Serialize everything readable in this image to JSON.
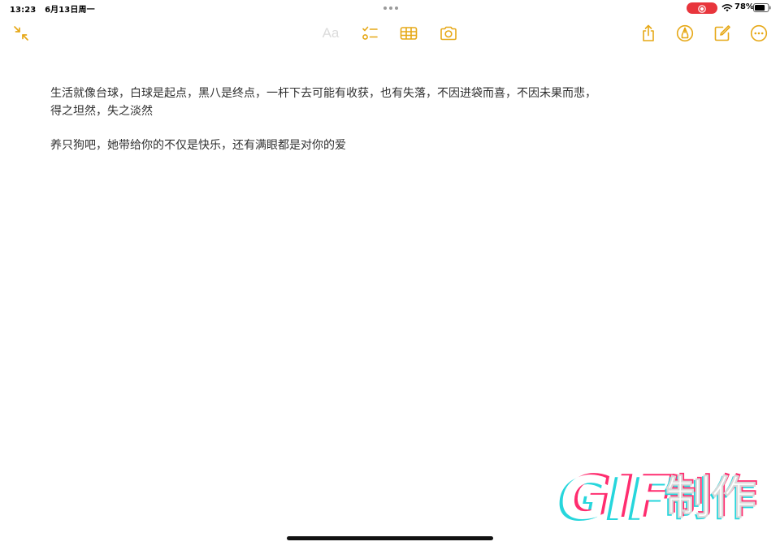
{
  "status_bar": {
    "time": "13:23",
    "date": "6月13日周一",
    "battery_percent": "78%",
    "battery_level": 0.78,
    "screen_recording": true,
    "record_color": "#e8353c"
  },
  "toolbar": {
    "accent_color": "#e6a817",
    "format_label": "Aa",
    "icons": {
      "collapse": "collapse-arrows-icon",
      "checklist": "checklist-icon",
      "table": "table-icon",
      "camera": "camera-icon",
      "share": "share-icon",
      "markup": "markup-pen-icon",
      "compose": "compose-icon",
      "more": "more-ellipsis-icon"
    }
  },
  "note": {
    "paragraphs": [
      {
        "lines": [
          "生活就像台球，白球是起点，黑八是终点，一杆下去可能有收获，也有失落，不因进袋而喜，不因未果而悲，",
          "得之坦然，失之淡然"
        ]
      },
      {
        "lines": [
          "养只狗吧，她带给你的不仅是快乐，还有满眼都是对你的爱"
        ]
      }
    ]
  },
  "watermark": {
    "text_gif": "GIF",
    "text_label": "制作"
  }
}
